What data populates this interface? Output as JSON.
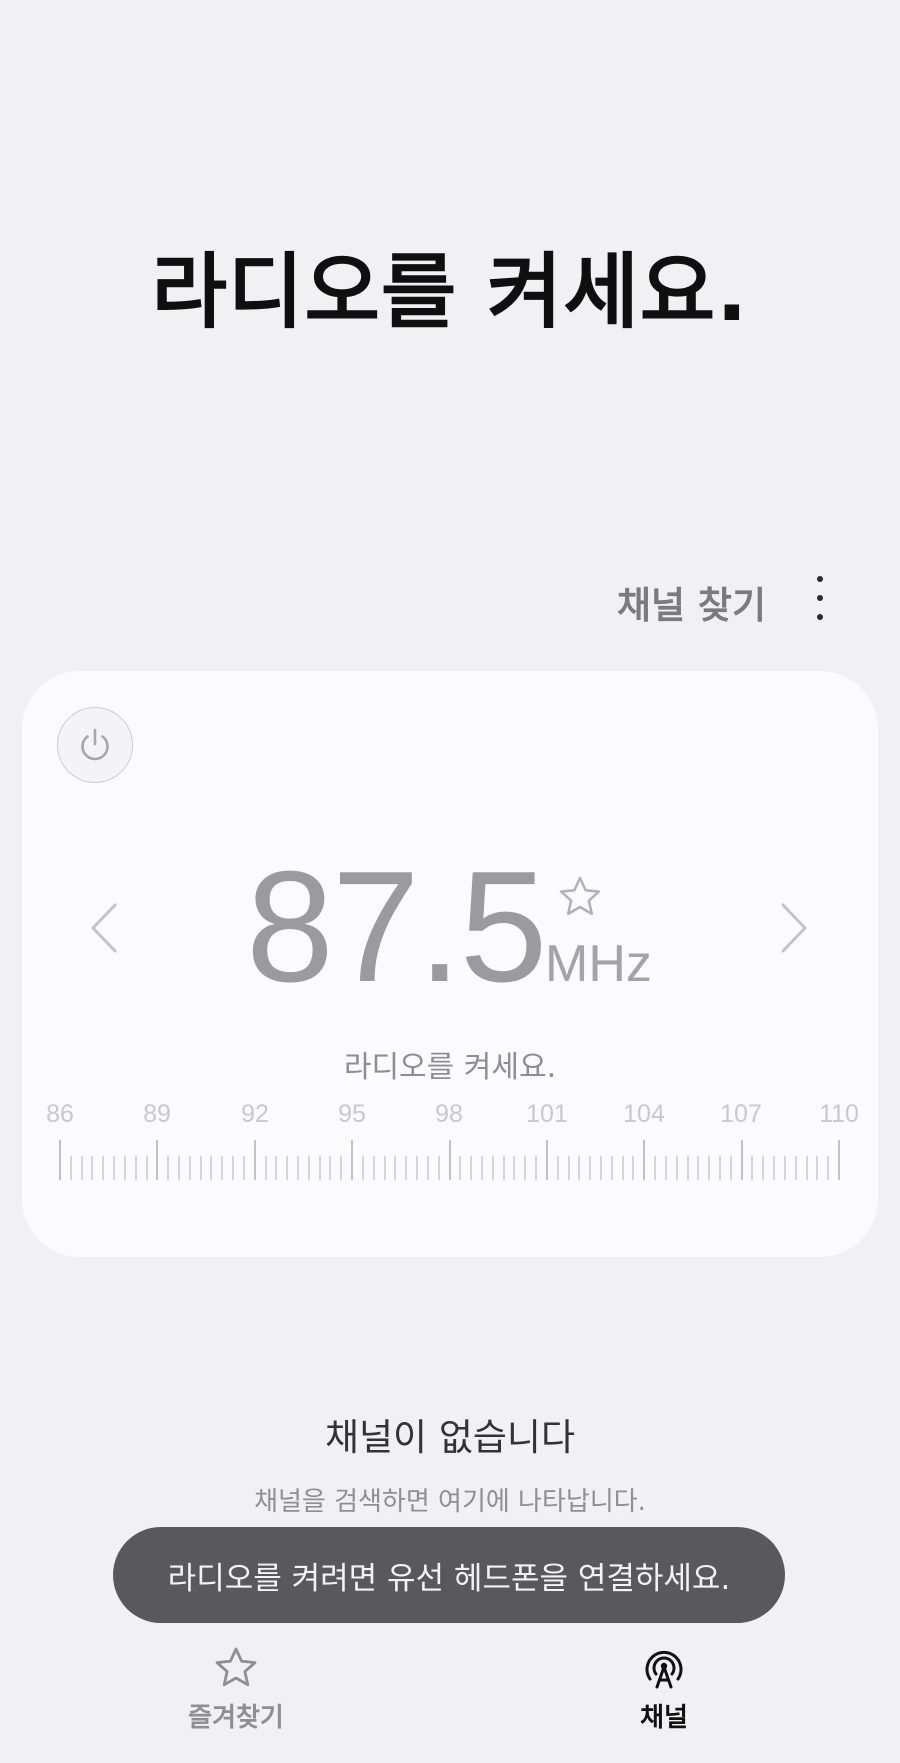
{
  "header": {
    "title": "라디오를 켜세요."
  },
  "toolbar": {
    "find_channels_label": "채널 찾기",
    "more_icon": "more-vertical-icon"
  },
  "tuner": {
    "power_icon": "power-icon",
    "prev_icon": "chevron-left-icon",
    "next_icon": "chevron-right-icon",
    "favorite_icon": "star-outline-icon",
    "frequency": "87.5",
    "unit": "MHz",
    "status": "라디오를 켜세요.",
    "scale_labels": [
      "86",
      "89",
      "92",
      "95",
      "98",
      "101",
      "104",
      "107",
      "110"
    ]
  },
  "channels": {
    "empty_title": "채널이 없습니다",
    "empty_subtitle": "채널을 검색하면 여기에 나타납니다."
  },
  "toast": {
    "message": "라디오를 켜려면 유선 헤드폰을 연결하세요."
  },
  "bottom_nav": {
    "tabs": [
      {
        "label": "즐겨찾기",
        "icon": "star-outline-icon",
        "active": false
      },
      {
        "label": "채널",
        "icon": "broadcast-antenna-icon",
        "active": true
      }
    ]
  },
  "colors": {
    "background": "#f1f1f3",
    "card": "#fbfbfd",
    "toast": "#59595b",
    "accent_active": "#111111",
    "inactive": "#8f8f93"
  }
}
